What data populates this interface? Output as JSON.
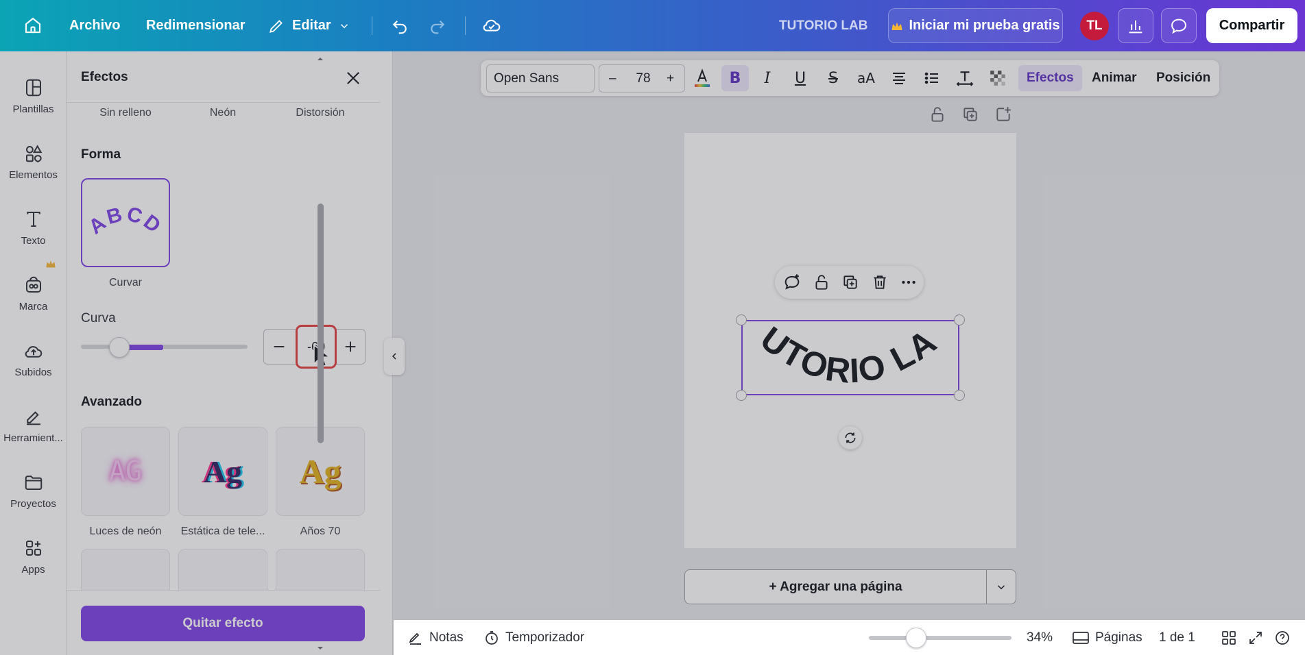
{
  "topbar": {
    "archivo": "Archivo",
    "redimensionar": "Redimensionar",
    "editar": "Editar",
    "doc_title": "TUTORIO LAB",
    "trial": "Iniciar mi prueba gratis",
    "avatar": "TL",
    "share": "Compartir"
  },
  "rail": {
    "items": [
      {
        "label": "Plantillas",
        "icon": "templates-icon"
      },
      {
        "label": "Elementos",
        "icon": "elements-icon"
      },
      {
        "label": "Texto",
        "icon": "text-icon"
      },
      {
        "label": "Marca",
        "icon": "brand-icon"
      },
      {
        "label": "Subidos",
        "icon": "uploads-icon"
      },
      {
        "label": "Herramient...",
        "icon": "tools-icon"
      },
      {
        "label": "Proyectos",
        "icon": "projects-icon"
      },
      {
        "label": "Apps",
        "icon": "apps-icon"
      }
    ]
  },
  "panel": {
    "title": "Efectos",
    "top_effects": [
      "Sin relleno",
      "Neón",
      "Distorsión"
    ],
    "shape_section": "Forma",
    "shape_option": "Curvar",
    "shape_preview": "ABCD",
    "curve_label": "Curva",
    "curve_value": "-60",
    "curve_level": -60,
    "advanced_section": "Avanzado",
    "advanced_effects": [
      "Luces de neón",
      "Estática de tele...",
      "Años 70"
    ],
    "advanced_preview": "Ag",
    "neon_preview": "AG",
    "remove_button": "Quitar efecto"
  },
  "toolbar": {
    "font": "Open Sans",
    "minus": "–",
    "size": "78",
    "plus": "+",
    "effects": "Efectos",
    "animate": "Animar",
    "position": "Posición"
  },
  "canvas": {
    "text": "TUTORIO LAB",
    "add_page": "+ Agregar una página"
  },
  "bottombar": {
    "notes": "Notas",
    "timer": "Temporizador",
    "zoom": "34%",
    "pages": "Páginas",
    "page_count": "1 de 1"
  },
  "colors": {
    "accent": "#7b3fe4",
    "highlight": "#e33b3b",
    "avatar": "#c41a3b"
  }
}
